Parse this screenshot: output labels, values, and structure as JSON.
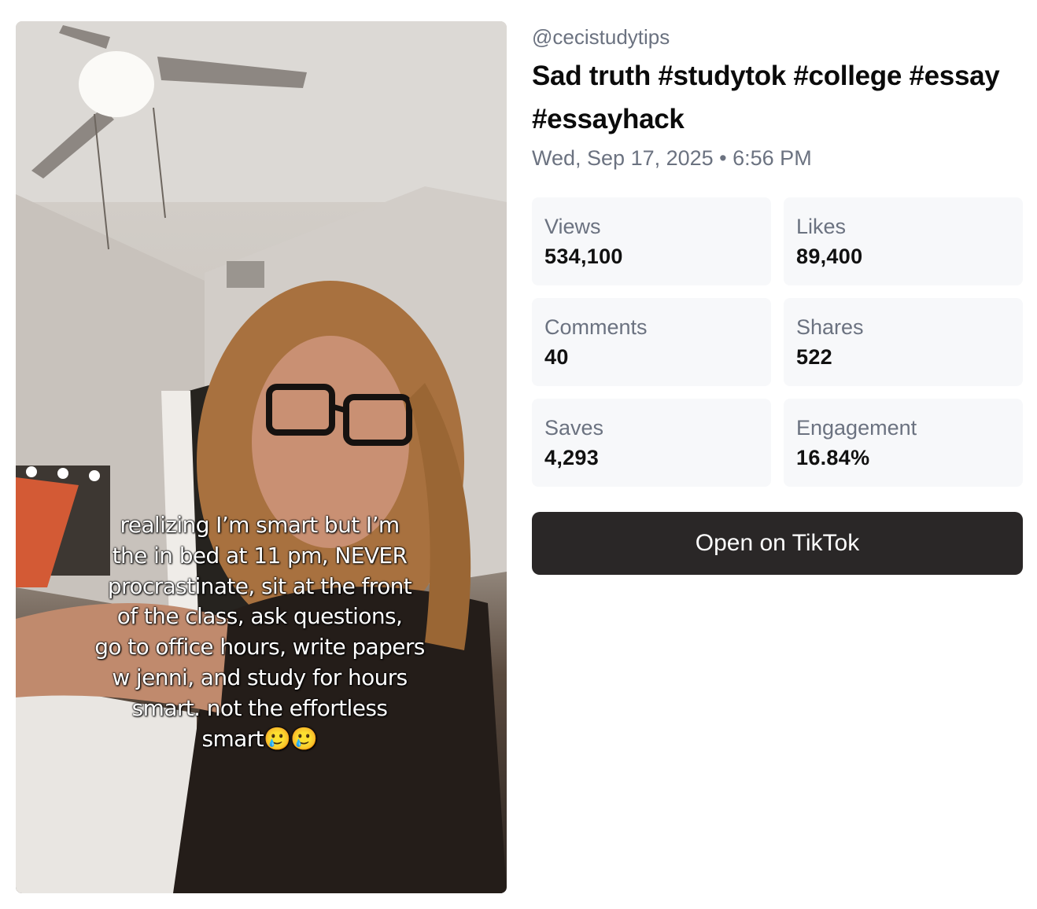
{
  "video": {
    "caption_overlay": "realizing I’m smart but I’m\nthe in bed at 11 pm, NEVER\nprocrastinate, sit at the front\nof the class, ask questions,\ngo to office hours, write papers\nw jenni, and study for hours\nsmart.  not the effortless\nsmart🥲🥲"
  },
  "post": {
    "handle": "@cecistudytips",
    "title": "Sad truth #studytok #college #essay #essayhack",
    "date": "Wed, Sep 17, 2025 • 6:56 PM"
  },
  "stats": [
    {
      "label": "Views",
      "value": "534,100"
    },
    {
      "label": "Likes",
      "value": "89,400"
    },
    {
      "label": "Comments",
      "value": "40"
    },
    {
      "label": "Shares",
      "value": "522"
    },
    {
      "label": "Saves",
      "value": "4,293"
    },
    {
      "label": "Engagement",
      "value": "16.84%"
    }
  ],
  "actions": {
    "open_label": "Open on TikTok"
  }
}
